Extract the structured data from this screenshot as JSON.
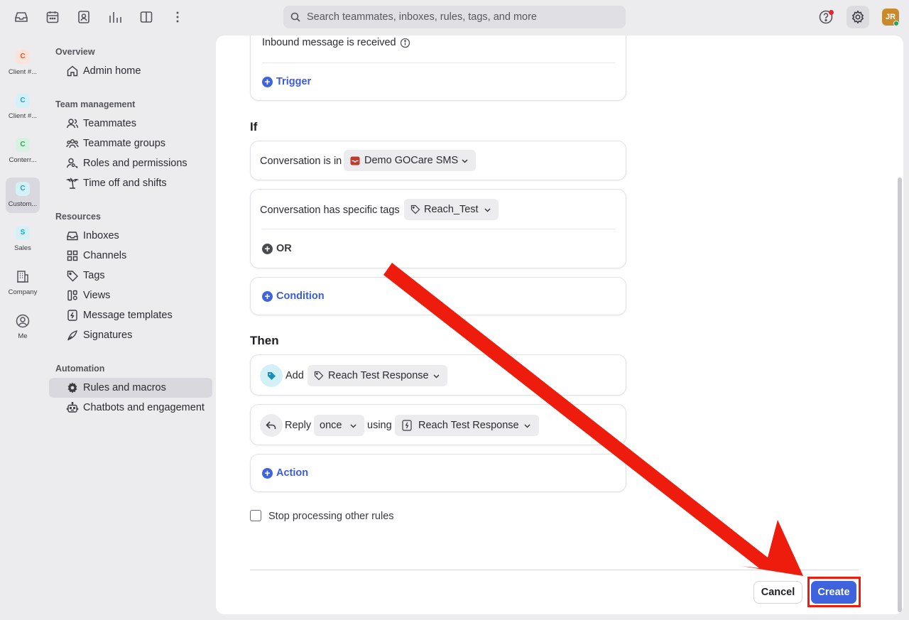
{
  "topbar": {
    "search_placeholder": "Search teammates, inboxes, rules, tags, and more",
    "avatar_initials": "JR"
  },
  "rail": {
    "items": [
      {
        "badge": "C",
        "label": "Client #...",
        "color": "#f4511e"
      },
      {
        "badge": "C",
        "label": "Client #...",
        "color": "#1da1c4"
      },
      {
        "badge": "C",
        "label": "Conterr...",
        "color": "#27a55a"
      },
      {
        "badge": "C",
        "label": "Custom...",
        "color": "#1da1c4"
      },
      {
        "badge": "S",
        "label": "Sales",
        "color": "#1da1c4"
      },
      {
        "label": "Company"
      },
      {
        "label": "Me"
      }
    ]
  },
  "nav": {
    "overview": "Overview",
    "admin_home": "Admin home",
    "team_management": "Team management",
    "teammates": "Teammates",
    "teammate_groups": "Teammate groups",
    "roles_permissions": "Roles and permissions",
    "time_off": "Time off and shifts",
    "resources": "Resources",
    "inboxes": "Inboxes",
    "channels": "Channels",
    "tags": "Tags",
    "views": "Views",
    "message_templates": "Message templates",
    "signatures": "Signatures",
    "automation": "Automation",
    "rules_macros": "Rules and macros",
    "chatbots": "Chatbots and engagement"
  },
  "rule": {
    "trigger_event": "Inbound message is received",
    "add_trigger": "Trigger",
    "if_heading": "If",
    "cond1_text": "Conversation is in",
    "cond1_value": "Demo GOCare SMS",
    "cond2_text": "Conversation has specific tags",
    "cond2_value": "Reach_Test",
    "or_label": "OR",
    "add_condition": "Condition",
    "then_heading": "Then",
    "action1_verb": "Add",
    "action1_value": "Reach Test Response",
    "action2_verb": "Reply",
    "action2_frequency": "once",
    "action2_using": "using",
    "action2_value": "Reach Test Response",
    "add_action": "Action",
    "stop_processing": "Stop processing other rules"
  },
  "footer": {
    "cancel": "Cancel",
    "create": "Create"
  },
  "colors": {
    "accent": "#3e63dd",
    "annotation": "#ee1c0c"
  }
}
